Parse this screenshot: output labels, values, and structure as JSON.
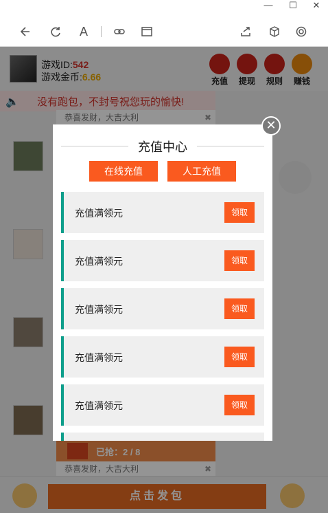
{
  "window": {
    "minimize_glyph": "—",
    "maximize_glyph": "☐",
    "close_glyph": "✕"
  },
  "toolbar": {
    "icons": [
      "back-icon",
      "refresh-icon",
      "text-size-icon",
      "link-icon",
      "window-icon",
      "share-icon",
      "cube-icon",
      "settings-icon"
    ],
    "font_glyph": "A"
  },
  "user": {
    "game_id_label": "游戏ID:",
    "game_id_value": "542",
    "game_coin_label": "游戏金币:",
    "game_coin_value": "6.66"
  },
  "quick_actions": [
    {
      "label": "充值",
      "icon": "recharge-icon",
      "color": "#c8231a"
    },
    {
      "label": "提现",
      "icon": "withdraw-icon",
      "color": "#c8231a"
    },
    {
      "label": "规则",
      "icon": "rules-icon",
      "color": "#c8231a"
    },
    {
      "label": "赚钱",
      "icon": "earn-icon",
      "color": "#e8880e"
    }
  ],
  "notice": {
    "text": "没有跑包，不封号祝您玩的愉快!"
  },
  "feed": {
    "caption": "恭喜发财，大吉大利",
    "redpack_status": "已抢：2 / 8"
  },
  "bottom": {
    "send_label": "点击发包"
  },
  "modal": {
    "title": "充值中心",
    "tabs": [
      "在线充值",
      "人工充值"
    ],
    "offers": [
      {
        "text": "充值满领元",
        "button": "领取"
      },
      {
        "text": "充值满领元",
        "button": "领取"
      },
      {
        "text": "充值满领元",
        "button": "领取"
      },
      {
        "text": "充值满领元",
        "button": "领取"
      },
      {
        "text": "充值满领元",
        "button": "领取"
      }
    ],
    "close_glyph": "✕"
  },
  "colors": {
    "accent": "#fa5a1f",
    "teal": "#0e9e8b"
  }
}
